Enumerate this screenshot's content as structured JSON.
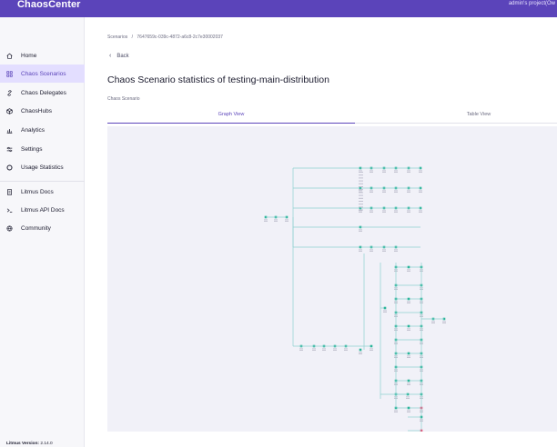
{
  "header": {
    "brand": "ChaosCenter",
    "user": "admin's project(Ow"
  },
  "sidebar": {
    "items": [
      {
        "label": "Home",
        "icon": "home-icon",
        "active": false
      },
      {
        "label": "Chaos Scenarios",
        "icon": "scenarios-icon",
        "active": true
      },
      {
        "label": "Chaos Delegates",
        "icon": "link-icon",
        "active": false
      },
      {
        "label": "ChaosHubs",
        "icon": "hub-icon",
        "active": false
      },
      {
        "label": "Analytics",
        "icon": "analytics-icon",
        "active": false
      },
      {
        "label": "Settings",
        "icon": "settings-icon",
        "active": false
      },
      {
        "label": "Usage Statistics",
        "icon": "usage-icon",
        "active": false
      },
      {
        "label": "Litmus Docs",
        "icon": "docs-icon",
        "active": false
      },
      {
        "label": "Litmus API Docs",
        "icon": "terminal-icon",
        "active": false
      },
      {
        "label": "Community",
        "icon": "community-icon",
        "active": false
      }
    ],
    "version_label": "Litmus Version:",
    "version_value": "2.14.0"
  },
  "main": {
    "breadcrumb_root": "Scenarios",
    "breadcrumb_sep": "/",
    "breadcrumb_id": "7647659c-039c-4872-a6c8-2c7e30002037",
    "back_label": "Back",
    "title": "Chaos Scenario statistics of testing-main-distribution",
    "section_label": "Chaos Scenario",
    "tabs": [
      {
        "label": "Graph View",
        "active": true
      },
      {
        "label": "Table View",
        "active": false
      }
    ]
  },
  "colors": {
    "brand": "#5b44ba",
    "active_bg": "#e3deff",
    "edge": "#8fd1d0",
    "node": "#2bb59a",
    "node_fail": "#e2557a"
  }
}
